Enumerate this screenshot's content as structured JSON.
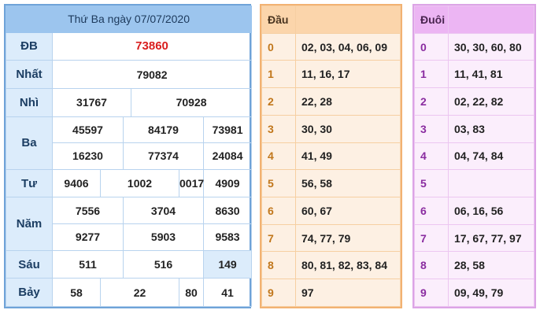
{
  "main": {
    "title": "Thứ Ba ngày 07/07/2020",
    "prizes": {
      "db": {
        "label": "ĐB",
        "values": [
          "73860"
        ]
      },
      "nhat": {
        "label": "Nhất",
        "values": [
          "79082"
        ]
      },
      "nhi": {
        "label": "Nhì",
        "values": [
          "31767",
          "70928"
        ]
      },
      "ba": {
        "label": "Ba",
        "values": [
          "45597",
          "84179",
          "73981",
          "16230",
          "77374",
          "24084"
        ]
      },
      "tu": {
        "label": "Tư",
        "values": [
          "9406",
          "1002",
          "0017",
          "4909"
        ]
      },
      "nam": {
        "label": "Năm",
        "values": [
          "7556",
          "3704",
          "8630",
          "9277",
          "5903",
          "9583"
        ]
      },
      "sau": {
        "label": "Sáu",
        "values": [
          "511",
          "516",
          "149"
        ]
      },
      "bay": {
        "label": "Bảy",
        "values": [
          "58",
          "22",
          "80",
          "41"
        ]
      }
    },
    "colors": {
      "header_bg": "#9cc5ee",
      "special_text": "#d91e1e",
      "border": "#6fa3d8"
    }
  },
  "dau": {
    "header": "Đầu",
    "rows": [
      {
        "k": "0",
        "v": "02, 03, 04, 06, 09"
      },
      {
        "k": "1",
        "v": "11, 16, 17"
      },
      {
        "k": "2",
        "v": "22, 28"
      },
      {
        "k": "3",
        "v": "30, 30"
      },
      {
        "k": "4",
        "v": "41, 49"
      },
      {
        "k": "5",
        "v": "56, 58"
      },
      {
        "k": "6",
        "v": "60, 67"
      },
      {
        "k": "7",
        "v": "74, 77, 79"
      },
      {
        "k": "8",
        "v": "80, 81, 82, 83, 84"
      },
      {
        "k": "9",
        "v": "97"
      }
    ],
    "colors": {
      "header_bg": "#fbd5ab",
      "border": "#f2b272"
    }
  },
  "duoi": {
    "header": "Đuôi",
    "rows": [
      {
        "k": "0",
        "v": "30, 30, 60, 80"
      },
      {
        "k": "1",
        "v": "11, 41, 81"
      },
      {
        "k": "2",
        "v": "02, 22, 82"
      },
      {
        "k": "3",
        "v": "03, 83"
      },
      {
        "k": "4",
        "v": "04, 74, 84"
      },
      {
        "k": "5",
        "v": ""
      },
      {
        "k": "6",
        "v": "06, 16, 56"
      },
      {
        "k": "7",
        "v": "17, 67, 77, 97"
      },
      {
        "k": "8",
        "v": "28, 58"
      },
      {
        "k": "9",
        "v": "09, 49, 79"
      }
    ],
    "colors": {
      "header_bg": "#ecb5f3",
      "border": "#dca4e6"
    }
  }
}
